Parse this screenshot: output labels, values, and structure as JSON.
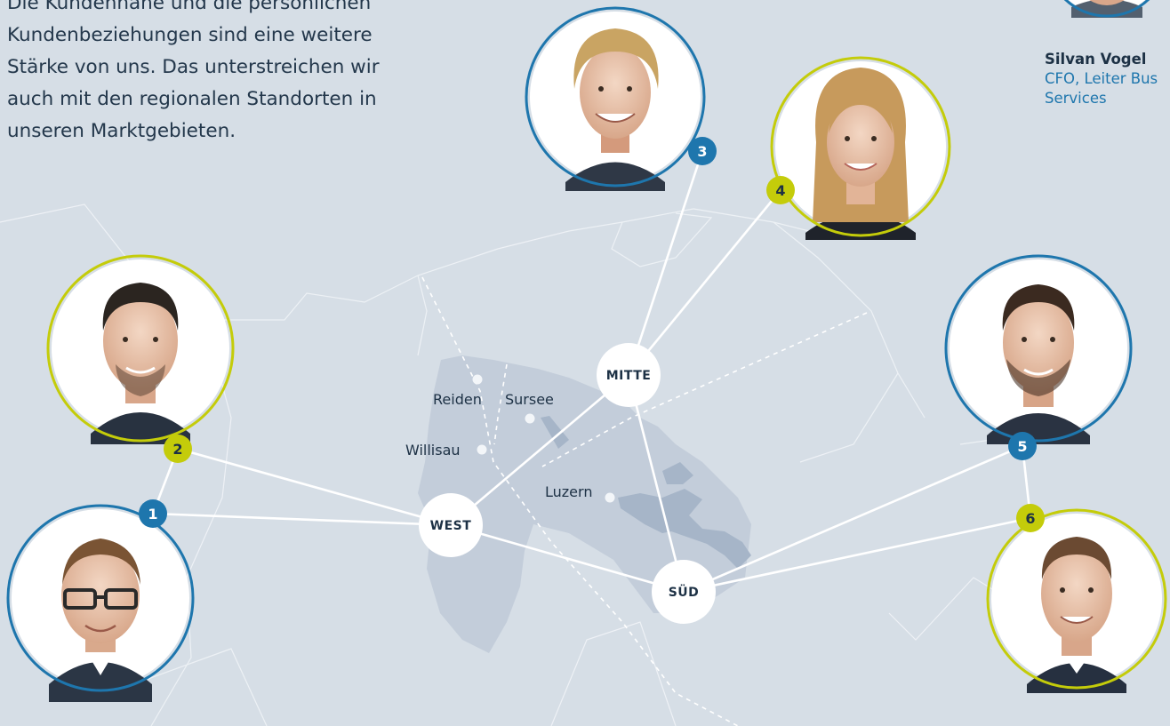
{
  "intro_lines": [
    "Die Kundennähe und die persönlichen",
    "Kundenbeziehungen sind eine weitere",
    "Stärke von uns. Das unterstreichen wir",
    "auch mit den regionalen Standorten in",
    "unseren Marktgebieten."
  ],
  "person": {
    "name": "Silvan Vogel",
    "role_line1": "CFO, Leiter Bus",
    "role_line2": "Services"
  },
  "hubs": {
    "mitte": "MITTE",
    "west": "WEST",
    "sued": "SÜD"
  },
  "places": {
    "reiden": "Reiden",
    "sursee": "Sursee",
    "willisau": "Willisau",
    "luzern": "Luzern"
  },
  "badges": {
    "b1": "1",
    "b2": "2",
    "b3": "3",
    "b4": "4",
    "b5": "5",
    "b6": "6"
  },
  "colors": {
    "background": "#d6dee6",
    "blue": "#1e76ad",
    "lime": "#c4cc0a",
    "region": "#c3cdda",
    "lake": "#a6b5c8"
  }
}
